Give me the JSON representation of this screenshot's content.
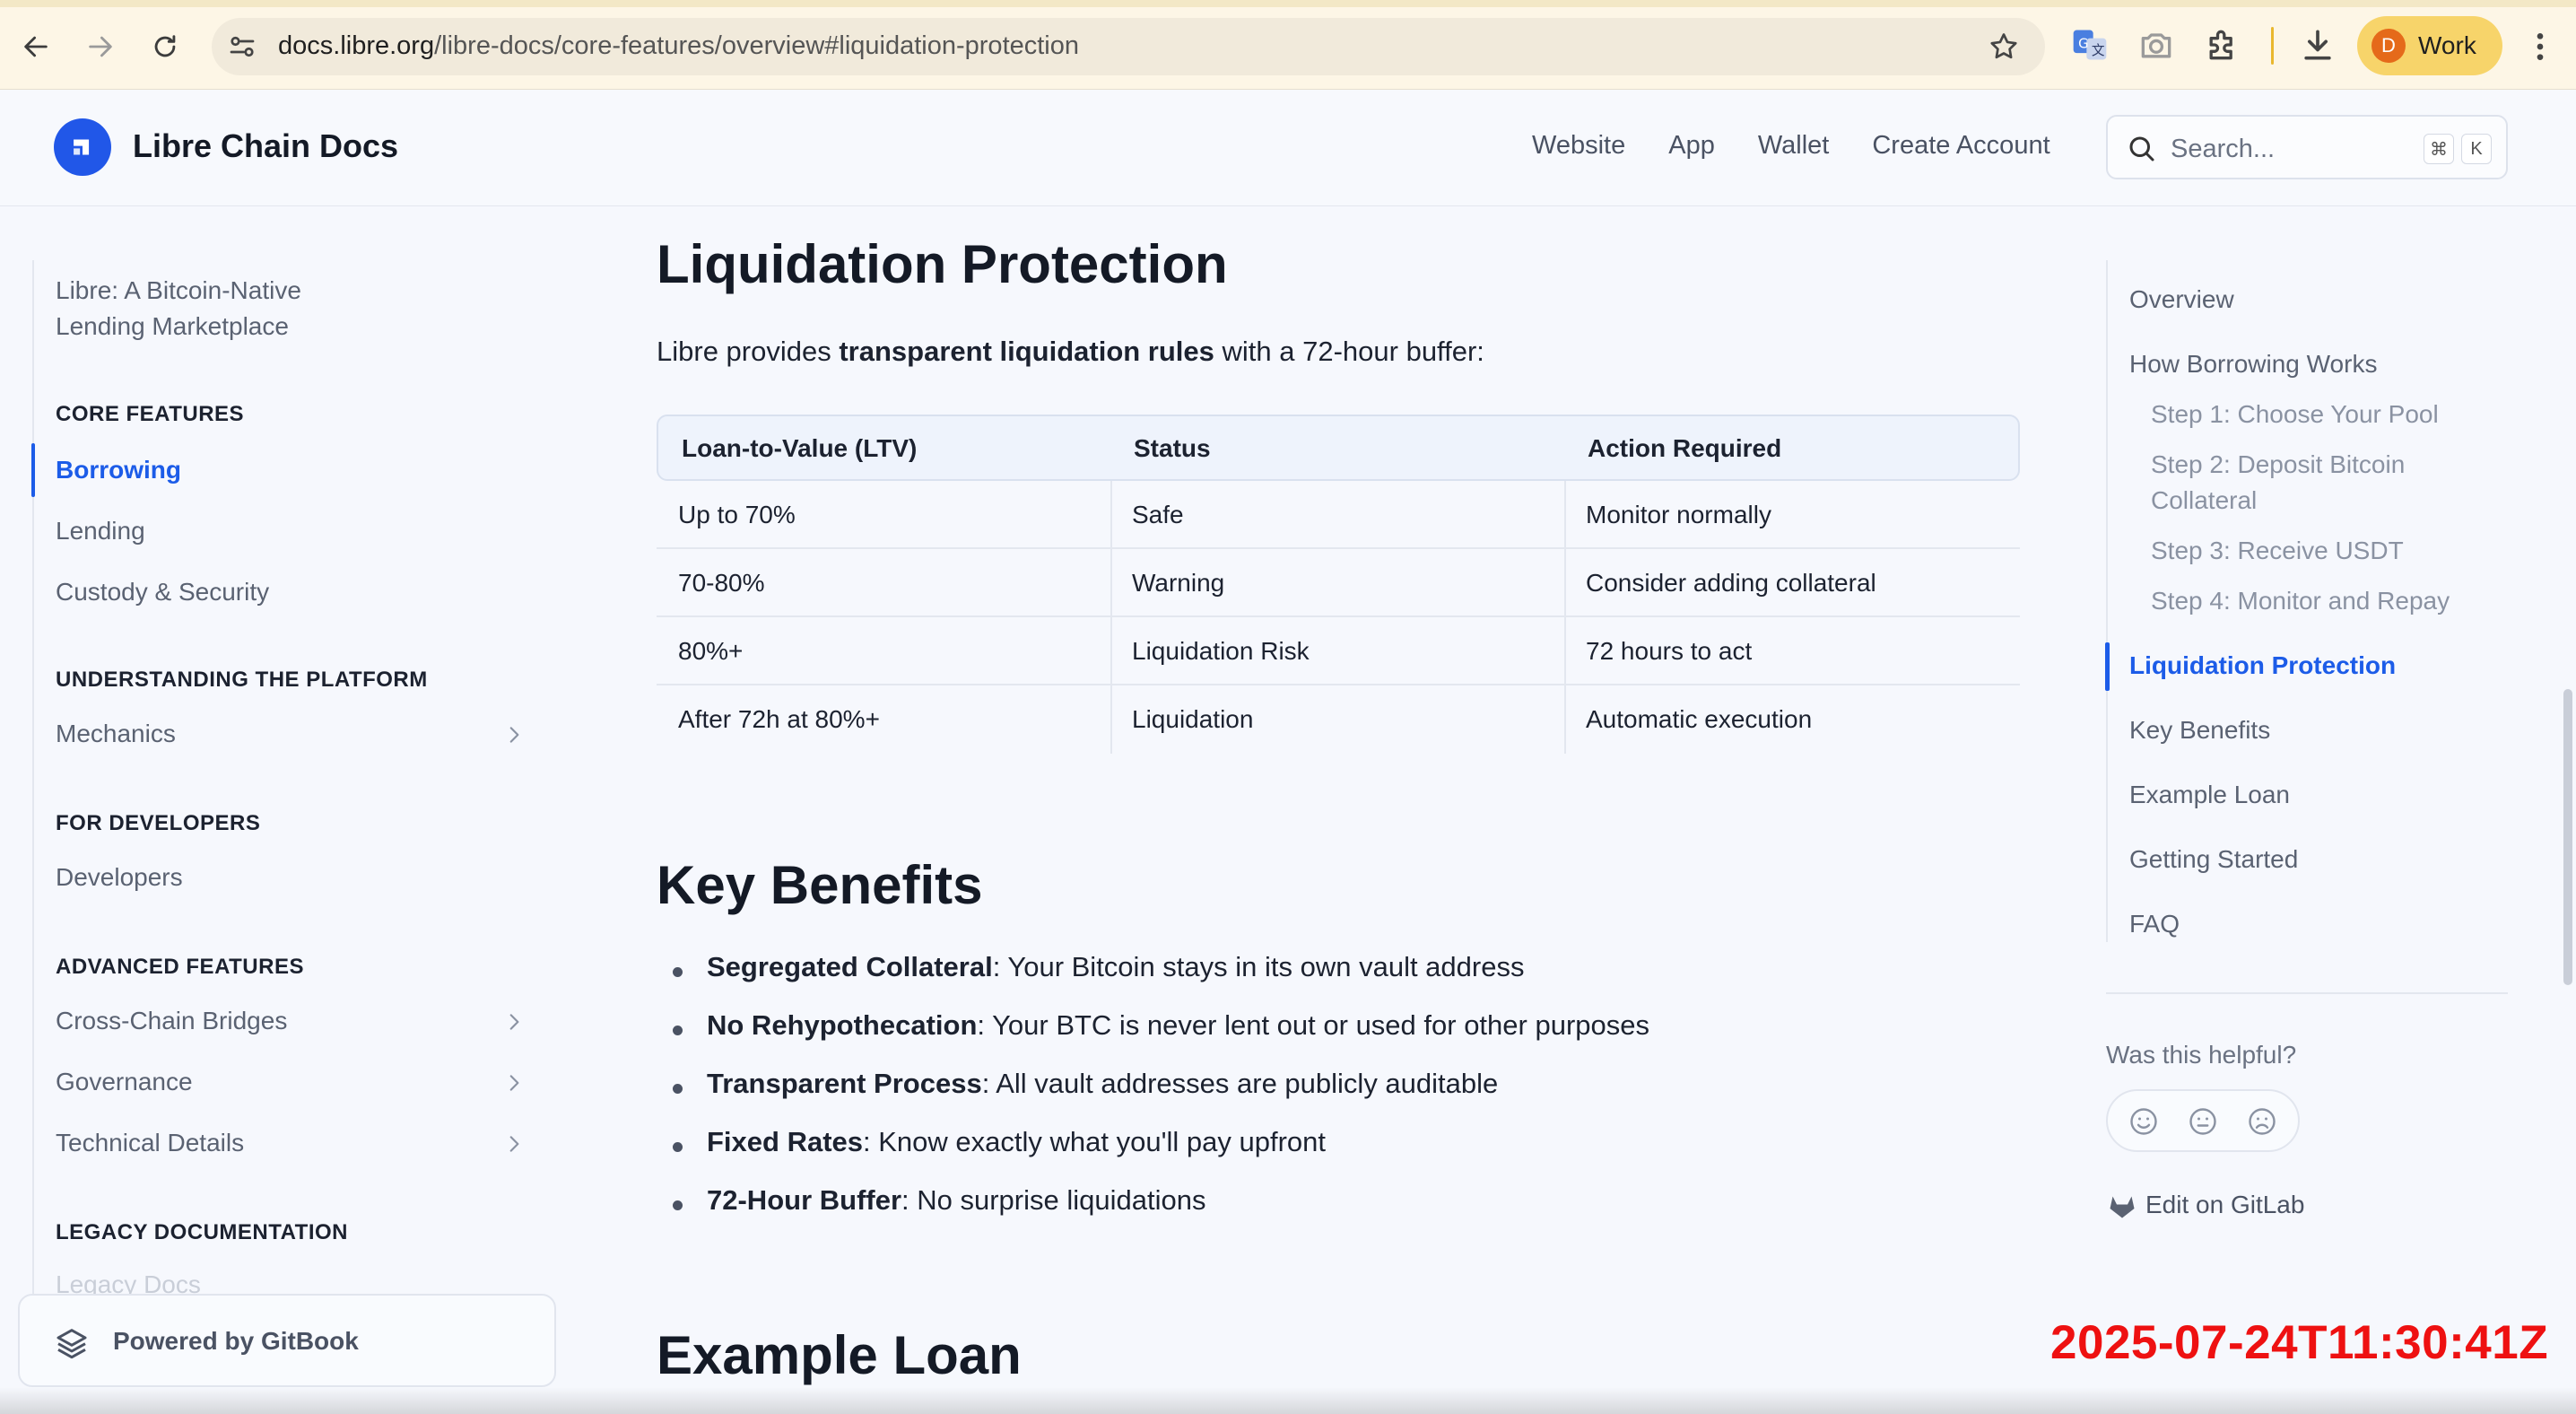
{
  "browser": {
    "url_host": "docs.libre.org",
    "url_path": "/libre-docs/core-features/overview#liquidation-protection",
    "profile_initial": "D",
    "profile_name": "Work"
  },
  "header": {
    "brand": "Libre Chain Docs",
    "links": [
      "Website",
      "App",
      "Wallet",
      "Create Account"
    ],
    "search_placeholder": "Search...",
    "kbd": [
      "⌘",
      "K"
    ]
  },
  "sidebar": {
    "intro": [
      "Libre: A Bitcoin-Native",
      "Lending Marketplace"
    ],
    "sections": [
      {
        "title": "CORE FEATURES",
        "items": [
          "Borrowing",
          "Lending",
          "Custody & Security"
        ]
      },
      {
        "title": "UNDERSTANDING THE PLATFORM",
        "items": [
          "Mechanics"
        ]
      },
      {
        "title": "FOR DEVELOPERS",
        "items": [
          "Developers"
        ]
      },
      {
        "title": "ADVANCED FEATURES",
        "items": [
          "Cross-Chain Bridges",
          "Governance",
          "Technical Details"
        ]
      },
      {
        "title": "LEGACY DOCUMENTATION",
        "items": [
          "Legacy Docs"
        ]
      }
    ],
    "powered_by": "Powered by GitBook"
  },
  "content": {
    "heading1": "Liquidation Protection",
    "intro_pre": "Libre provides ",
    "intro_bold": "transparent liquidation rules",
    "intro_post": " with a 72-hour buffer:",
    "table": {
      "headers": [
        "Loan-to-Value (LTV)",
        "Status",
        "Action Required"
      ],
      "rows": [
        [
          "Up to 70%",
          "Safe",
          "Monitor normally"
        ],
        [
          "70-80%",
          "Warning",
          "Consider adding collateral"
        ],
        [
          "80%+",
          "Liquidation Risk",
          "72 hours to act"
        ],
        [
          "After 72h at 80%+",
          "Liquidation",
          "Automatic execution"
        ]
      ]
    },
    "heading2": "Key Benefits",
    "benefits": [
      {
        "bold": "Segregated Collateral",
        "text": ": Your Bitcoin stays in its own vault address"
      },
      {
        "bold": "No Rehypothecation",
        "text": ": Your BTC is never lent out or used for other purposes"
      },
      {
        "bold": "Transparent Process",
        "text": ": All vault addresses are publicly auditable"
      },
      {
        "bold": "Fixed Rates",
        "text": ": Know exactly what you'll pay upfront"
      },
      {
        "bold": "72-Hour Buffer",
        "text": ": No surprise liquidations"
      }
    ],
    "heading3": "Example Loan"
  },
  "toc": {
    "items": [
      {
        "label": "Overview"
      },
      {
        "label": "How Borrowing Works"
      },
      {
        "label": "Step 1: Choose Your Pool"
      },
      {
        "label": "Step 2: Deposit Bitcoin"
      },
      {
        "label": "Collateral"
      },
      {
        "label": "Step 3: Receive USDT"
      },
      {
        "label": "Step 4: Monitor and Repay"
      },
      {
        "label": "Liquidation Protection"
      },
      {
        "label": "Key Benefits"
      },
      {
        "label": "Example Loan"
      },
      {
        "label": "Getting Started"
      },
      {
        "label": "FAQ"
      }
    ],
    "helpful": "Was this helpful?",
    "edit": "Edit on GitLab"
  },
  "timestamp": "2025-07-24T11:30:41Z",
  "colors": {
    "accent": "#1c5ce8",
    "timestamp": "#ee1111",
    "profile": "#f7d46a"
  }
}
